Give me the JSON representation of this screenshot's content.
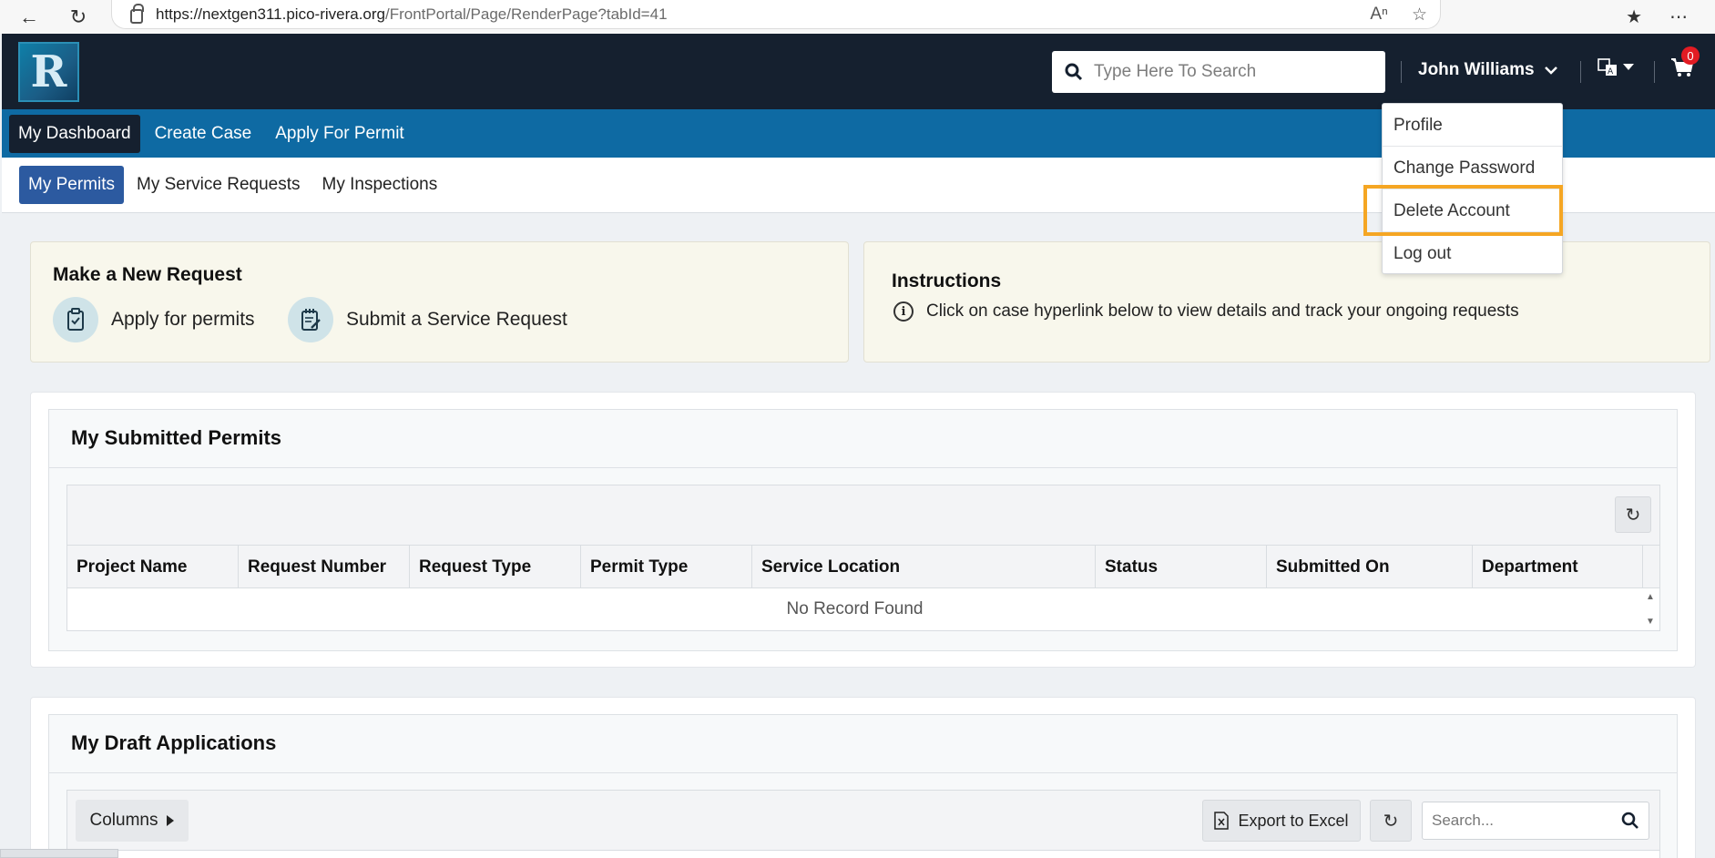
{
  "browser": {
    "url_host": "https://nextgen311.pico-rivera.org",
    "url_path": "/FrontPortal/Page/RenderPage?tabId=41"
  },
  "header": {
    "logo_text": "R",
    "search_placeholder": "Type Here To Search",
    "user_name": "John Williams",
    "cart_count": "0"
  },
  "user_menu": {
    "items": [
      "Profile",
      "Change Password",
      "Delete Account",
      "Log out"
    ],
    "highlighted": "Delete Account",
    "highlight_color": "#f5a623"
  },
  "nav": {
    "items": [
      "My Dashboard",
      "Create Case",
      "Apply For Permit"
    ],
    "active": "My Dashboard"
  },
  "subnav": {
    "items": [
      "My Permits",
      "My Service Requests",
      "My Inspections"
    ],
    "active": "My Permits"
  },
  "new_request": {
    "title": "Make a New Request",
    "links": [
      "Apply for permits",
      "Submit a Service Request"
    ]
  },
  "instructions": {
    "title": "Instructions",
    "text": "Click on case hyperlink below to view details and track your ongoing requests"
  },
  "submitted_permits": {
    "title": "My Submitted Permits",
    "columns": [
      "Project Name",
      "Request Number",
      "Request Type",
      "Permit Type",
      "Service Location",
      "Status",
      "Submitted On",
      "Department"
    ],
    "empty_text": "No Record Found"
  },
  "draft_applications": {
    "title": "My Draft Applications",
    "columns_button": "Columns",
    "export_button": "Export to Excel",
    "search_placeholder": "Search..."
  },
  "colors": {
    "header_bg": "#15202f",
    "nav_bg": "#0e6aa3",
    "active_subtab": "#2c5aa0",
    "card_bg": "#f8f7ec"
  }
}
